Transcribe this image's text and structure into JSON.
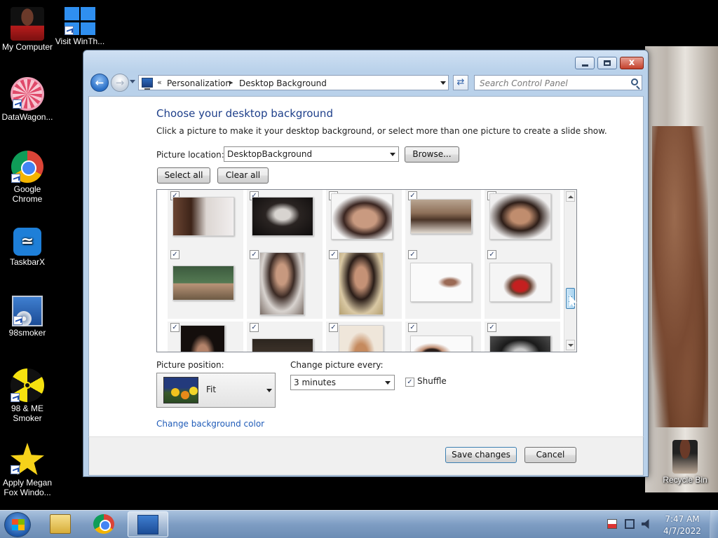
{
  "desktop": {
    "icons": [
      {
        "label": "My Computer",
        "icon": "photo-icon"
      },
      {
        "label": "Visit WinTh...",
        "icon": "windows-logo-icon"
      },
      {
        "label": "DataWagon...",
        "icon": "pink-flower-icon"
      },
      {
        "label": "Google Chrome",
        "icon": "chrome-icon"
      },
      {
        "label": "TaskbarX",
        "icon": "taskbarx-icon"
      },
      {
        "label": "98smoker",
        "icon": "installer-icon"
      },
      {
        "label": "98 & ME Smoker",
        "icon": "radiation-icon"
      },
      {
        "label": "Apply Megan Fox Windo...",
        "icon": "star-icon"
      },
      {
        "label": "Recycle Bin",
        "icon": "recycle-bin-icon"
      }
    ]
  },
  "window": {
    "breadcrumb": [
      "Personalization",
      "Desktop Background"
    ],
    "search_placeholder": "Search Control Panel",
    "heading": "Choose your desktop background",
    "instruction": "Click a picture to make it your desktop background, or select more than one picture to create a slide show.",
    "picture_location_label": "Picture location:",
    "picture_location_value": "DesktopBackground",
    "browse_label": "Browse...",
    "select_all_label": "Select all",
    "clear_all_label": "Clear all",
    "thumbnails": [
      {
        "checked": true
      },
      {
        "checked": true
      },
      {
        "checked": true
      },
      {
        "checked": true
      },
      {
        "checked": true
      },
      {
        "checked": true
      },
      {
        "checked": true
      },
      {
        "checked": true
      },
      {
        "checked": true
      },
      {
        "checked": true
      },
      {
        "checked": true
      },
      {
        "checked": true
      },
      {
        "checked": true
      },
      {
        "checked": true
      },
      {
        "checked": true
      }
    ],
    "picture_position_label": "Picture position:",
    "picture_position_value": "Fit",
    "change_every_label": "Change picture every:",
    "change_every_value": "3 minutes",
    "shuffle_label": "Shuffle",
    "shuffle_checked": true,
    "change_bg_color_link": "Change background color",
    "save_label": "Save changes",
    "cancel_label": "Cancel",
    "close_glyph": "x"
  },
  "taskbar": {
    "time": "7:47 AM",
    "date": "4/7/2022"
  },
  "colors": {
    "heading": "#1e3f8a",
    "link": "#1f5bb8",
    "window_frame": "#b9d1ea",
    "taskbar": "#7e9dc3"
  }
}
